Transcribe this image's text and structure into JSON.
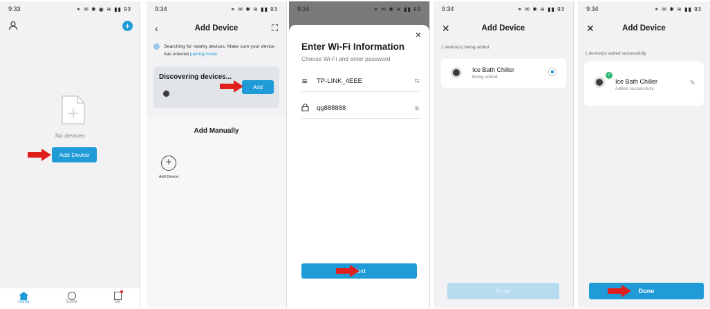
{
  "screen1": {
    "time": "9:33",
    "status_icons": "⚭ ✉ ✱ ◉ ≋ ▮▮ 93",
    "empty_label": "No devices",
    "add_button": "Add Device",
    "nav": [
      {
        "label": "Home"
      },
      {
        "label": "Scene"
      },
      {
        "label": "Me"
      }
    ]
  },
  "screen2": {
    "time": "9:34",
    "status_icons": "⚭ ✉ ✱ ≋ ▮▮ 93",
    "title": "Add Device",
    "search_text": "Searching for nearby devices. Make sure your device has entered",
    "search_link": "pairing mode.",
    "discovering": "Discovering devices...",
    "add_button": "Add",
    "manual_title": "Add Manually",
    "manual_item": "Add Device"
  },
  "screen3": {
    "time": "9:34",
    "status_icons": "⚭ ✉ ✱ ≋ ▮▮ 93",
    "title": "Enter Wi-Fi Information",
    "subtitle": "Choose Wi-Fi and enter password",
    "ssid": "TP-LINK_4EEE",
    "password": "qg888888",
    "next_button": "Next"
  },
  "screen4": {
    "time": "9:34",
    "status_icons": "⚭ ✉ ✱ ≋ ▮▮ 93",
    "title": "Add Device",
    "count_text": "1 device(s) being added",
    "device_name": "Ice Bath Chiller",
    "device_status": "Being added",
    "done_button": "Done"
  },
  "screen5": {
    "time": "9:34",
    "status_icons": "⚭ ✉ ✱ ≋ ▮▮ 93",
    "title": "Add Device",
    "count_text": "1 device(s) added successfully",
    "device_name": "Ice Bath Chiller",
    "device_status": "Added successfully",
    "done_button": "Done"
  },
  "colors": {
    "accent": "#1f9bd7",
    "arrow": "#e0201d",
    "success": "#2fb873"
  }
}
